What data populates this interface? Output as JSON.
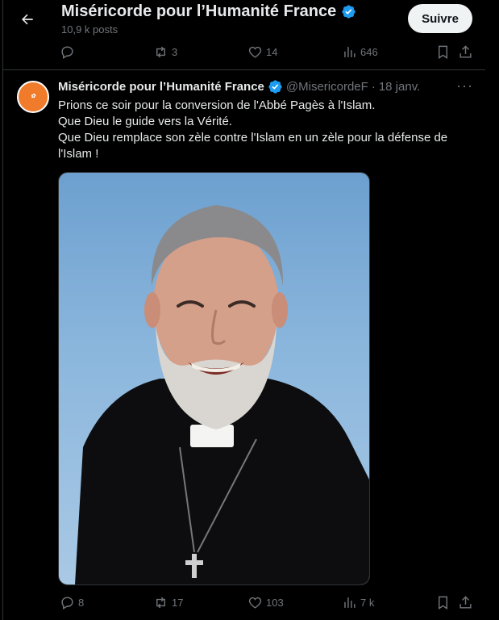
{
  "header": {
    "title": "Miséricorde pour l’Humanité France",
    "posts_count": "10,9 k posts",
    "follow_label": "Suivre"
  },
  "prev_tweet": {
    "replies": "",
    "reposts": "3",
    "likes": "14",
    "views": "646"
  },
  "tweet": {
    "author_name": "Miséricorde pour l’Humanité France",
    "handle": "@MisericordeF",
    "separator": "·",
    "date": "18 janv.",
    "more": "···",
    "lines": [
      "Prions ce soir pour la conversion de l'Abbé Pagès à l'Islam.",
      "Que Dieu le guide vers la Vérité.",
      "Que Dieu remplace son zèle contre l'Islam en un zèle pour la défense de l'Islam !"
    ],
    "media_alt": "Photo of a smiling bearded priest with clerical collar",
    "replies": "8",
    "reposts": "17",
    "likes": "103",
    "views": "7 k"
  },
  "colors": {
    "background": "#000000",
    "text": "#e7e9ea",
    "muted": "#71767b",
    "verified": "#1d9bf0",
    "avatar": "#f07b2a"
  },
  "icons": {
    "back": "arrow-left-icon",
    "verified": "verified-badge-icon",
    "reply": "reply-icon",
    "repost": "repost-icon",
    "like": "heart-icon",
    "views": "views-icon",
    "bookmark": "bookmark-icon",
    "share": "share-icon"
  }
}
